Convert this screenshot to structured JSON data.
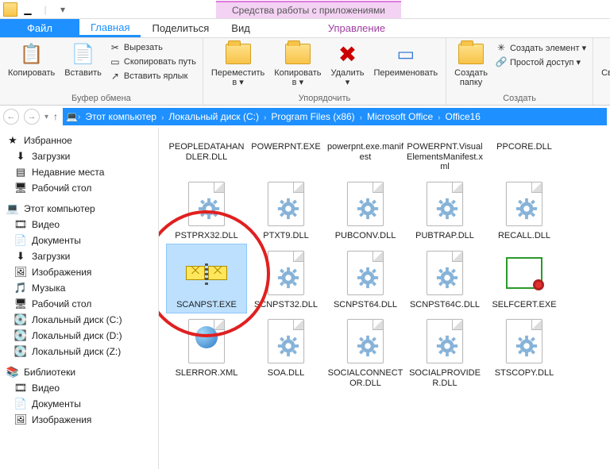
{
  "titlebar": {
    "context_label": "Средства работы с приложениями"
  },
  "tabs": {
    "file": "Файл",
    "home": "Главная",
    "share": "Поделиться",
    "view": "Вид",
    "manage": "Управление"
  },
  "ribbon": {
    "clipboard": {
      "label": "Буфер обмена",
      "copy": "Копировать",
      "paste": "Вставить",
      "cut": "Вырезать",
      "copy_path": "Скопировать путь",
      "paste_shortcut": "Вставить ярлык"
    },
    "organize": {
      "label": "Упорядочить",
      "move_to": "Переместить\nв ▾",
      "copy_to": "Копировать\nв ▾",
      "delete": "Удалить\n▾",
      "rename": "Переименовать"
    },
    "create": {
      "label": "Создать",
      "new_folder": "Создать\nпапку",
      "new_item": "Создать элемент ▾",
      "easy_access": "Простой доступ ▾"
    },
    "open": {
      "properties": "Свойства\n▾"
    }
  },
  "breadcrumb": {
    "items": [
      "Этот компьютер",
      "Локальный диск (C:)",
      "Program Files (x86)",
      "Microsoft Office",
      "Office16"
    ]
  },
  "sidebar": {
    "favorites": {
      "label": "Избранное",
      "items": [
        {
          "icon": "download-icon",
          "label": "Загрузки"
        },
        {
          "icon": "recent-icon",
          "label": "Недавние места"
        },
        {
          "icon": "desktop-icon",
          "label": "Рабочий стол"
        }
      ]
    },
    "computer": {
      "label": "Этот компьютер",
      "items": [
        {
          "icon": "video-icon",
          "label": "Видео"
        },
        {
          "icon": "documents-icon",
          "label": "Документы"
        },
        {
          "icon": "download-icon",
          "label": "Загрузки"
        },
        {
          "icon": "images-icon",
          "label": "Изображения"
        },
        {
          "icon": "music-icon",
          "label": "Музыка"
        },
        {
          "icon": "desktop-icon",
          "label": "Рабочий стол"
        },
        {
          "icon": "disk-icon",
          "label": "Локальный диск (C:)"
        },
        {
          "icon": "disk-icon",
          "label": "Локальный диск (D:)"
        },
        {
          "icon": "disk-icon",
          "label": "Локальный диск (Z:)"
        }
      ]
    },
    "libraries": {
      "label": "Библиотеки",
      "items": [
        {
          "icon": "video-icon",
          "label": "Видео"
        },
        {
          "icon": "documents-icon",
          "label": "Документы"
        },
        {
          "icon": "images-icon",
          "label": "Изображения"
        }
      ]
    }
  },
  "files": {
    "row1": [
      {
        "name": "PEOPLEDATAHANDLER.DLL"
      },
      {
        "name": "POWERPNT.EXE"
      },
      {
        "name": "powerpnt.exe.manifest"
      },
      {
        "name": "POWERPNT.VisualElementsManifest.xml"
      },
      {
        "name": "PPCORE.DLL"
      }
    ],
    "row2": [
      {
        "name": "PSTPRX32.DLL",
        "kind": "gear"
      },
      {
        "name": "PTXT9.DLL",
        "kind": "gear"
      },
      {
        "name": "PUBCONV.DLL",
        "kind": "gear"
      },
      {
        "name": "PUBTRAP.DLL",
        "kind": "gear"
      },
      {
        "name": "RECALL.DLL",
        "kind": "gear"
      }
    ],
    "row3": [
      {
        "name": "SCANPST.EXE",
        "kind": "scanpst",
        "selected": true,
        "highlight": true
      },
      {
        "name": "SCNPST32.DLL",
        "kind": "gear"
      },
      {
        "name": "SCNPST64.DLL",
        "kind": "gear"
      },
      {
        "name": "SCNPST64C.DLL",
        "kind": "gear"
      },
      {
        "name": "SELFCERT.EXE",
        "kind": "cert"
      }
    ],
    "row4": [
      {
        "name": "SLERROR.XML",
        "kind": "globe"
      },
      {
        "name": "SOA.DLL",
        "kind": "gear"
      },
      {
        "name": "SOCIALCONNECTOR.DLL",
        "kind": "gear"
      },
      {
        "name": "SOCIALPROVIDER.DLL",
        "kind": "gear"
      },
      {
        "name": "STSCOPY.DLL",
        "kind": "gear"
      }
    ]
  }
}
